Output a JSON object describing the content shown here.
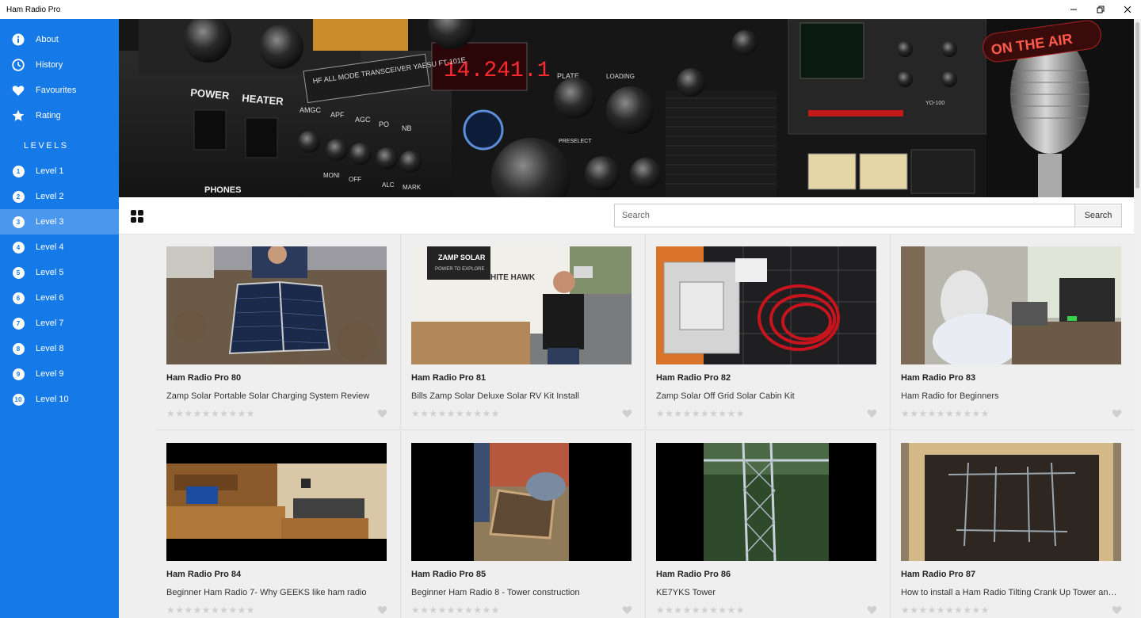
{
  "window": {
    "title": "Ham Radio Pro"
  },
  "sidebar": {
    "items": [
      {
        "label": "About",
        "icon": "info-icon"
      },
      {
        "label": "History",
        "icon": "clock-icon"
      },
      {
        "label": "Favourites",
        "icon": "heart-icon"
      },
      {
        "label": "Rating",
        "icon": "star-icon"
      }
    ],
    "levels_heading": "LEVELS",
    "levels": [
      {
        "num": "1",
        "label": "Level 1"
      },
      {
        "num": "2",
        "label": "Level 2"
      },
      {
        "num": "3",
        "label": "Level 3",
        "active": true
      },
      {
        "num": "4",
        "label": "Level 4"
      },
      {
        "num": "5",
        "label": "Level 5"
      },
      {
        "num": "6",
        "label": "Level 6"
      },
      {
        "num": "7",
        "label": "Level 7"
      },
      {
        "num": "8",
        "label": "Level 8"
      },
      {
        "num": "9",
        "label": "Level 9"
      },
      {
        "num": "10",
        "label": "Level 10"
      }
    ]
  },
  "banner": {
    "display_freq": "14.241.1",
    "brand_plate": "HF ALL MODE TRANSCEIVER YAESU FT-101E",
    "labels": [
      "POWER",
      "HEATER",
      "AMGC",
      "APF",
      "AGC",
      "PO",
      "NB",
      "PLATE",
      "LOADING",
      "PHONES",
      "PRESELECT",
      "MONI",
      "OFF",
      "ALC",
      "MARK"
    ],
    "sign": "ON THE AIR",
    "radio2": "YO-100"
  },
  "toolbar": {
    "search_placeholder": "Search",
    "search_button": "Search"
  },
  "videos": [
    {
      "title": "Ham Radio Pro 80",
      "desc": "Zamp Solar Portable Solar Charging System Review",
      "rating": 0
    },
    {
      "title": "Ham Radio Pro 81",
      "desc": "Bills Zamp Solar Deluxe Solar RV Kit Install",
      "rating": 0
    },
    {
      "title": "Ham Radio Pro 82",
      "desc": "Zamp Solar Off Grid Solar Cabin Kit",
      "rating": 0
    },
    {
      "title": "Ham Radio Pro 83",
      "desc": "Ham Radio for Beginners",
      "rating": 0
    },
    {
      "title": "Ham Radio Pro 84",
      "desc": "Beginner Ham Radio 7- Why GEEKS like ham radio",
      "rating": 0
    },
    {
      "title": "Ham Radio Pro 85",
      "desc": "Beginner Ham Radio 8 - Tower construction",
      "rating": 0
    },
    {
      "title": "Ham Radio Pro 86",
      "desc": "KE7YKS Tower",
      "rating": 0
    },
    {
      "title": "Ham Radio Pro 87",
      "desc": "How to install a Ham Radio Tilting Crank Up Tower and Mast",
      "rating": 0
    }
  ],
  "thumb_text": {
    "zamp_logo": "ZAMP SOLAR",
    "zamp_tag": "POWER TO EXPLORE",
    "white_hawk": "HITE HAWK"
  },
  "colors": {
    "sidebar": "#1579e8",
    "sidebar_active": "#4a98ee",
    "content_bg": "#efefef"
  }
}
